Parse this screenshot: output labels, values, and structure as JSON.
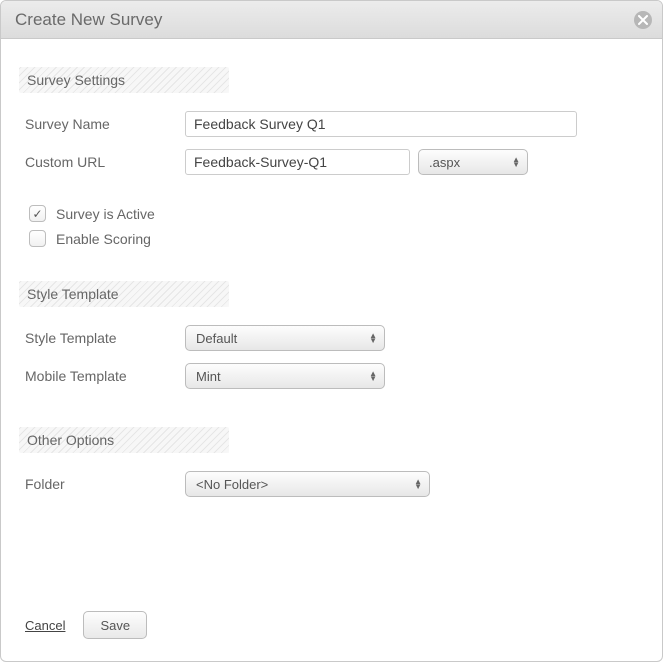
{
  "modal": {
    "title": "Create New Survey"
  },
  "sections": {
    "settings": "Survey Settings",
    "style": "Style Template",
    "other": "Other Options"
  },
  "labels": {
    "survey_name": "Survey Name",
    "custom_url": "Custom URL",
    "active": "Survey is Active",
    "scoring": "Enable Scoring",
    "style_template": "Style Template",
    "mobile_template": "Mobile Template",
    "folder": "Folder"
  },
  "values": {
    "survey_name": "Feedback Survey Q1",
    "custom_url": "Feedback-Survey-Q1",
    "extension": ".aspx",
    "active_checked": true,
    "scoring_checked": false,
    "style_template": "Default",
    "mobile_template": "Mint",
    "folder": "<No Folder>"
  },
  "actions": {
    "cancel": "Cancel",
    "save": "Save"
  }
}
